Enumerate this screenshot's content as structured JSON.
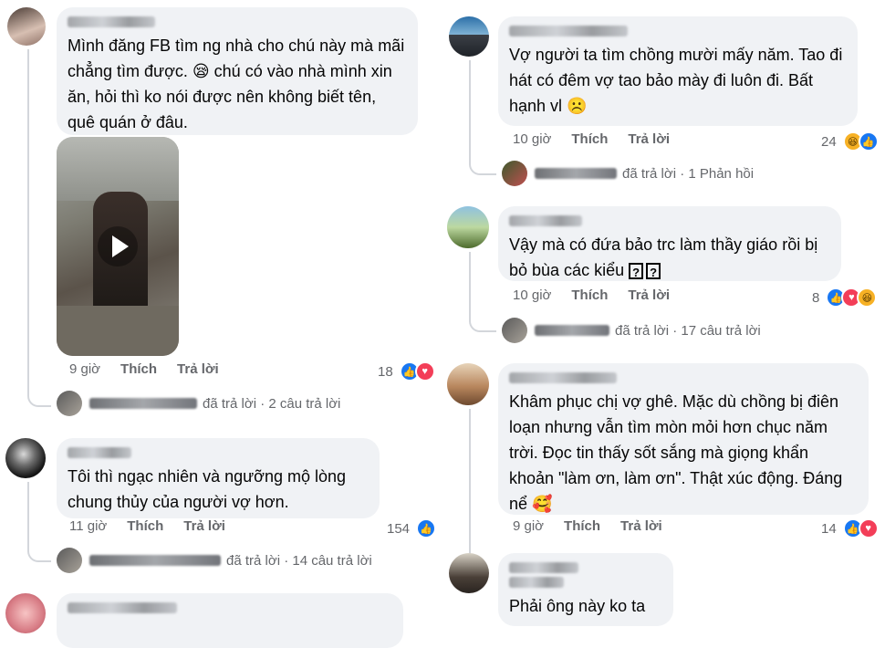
{
  "left": {
    "c1": {
      "text": "Mình đăng FB tìm ng nhà cho chú này mà mãi chẳng tìm được. 😪 chú có vào nhà mình xin ăn, hỏi thì ko nói được nên không biết tên, quê quán ở đâu.",
      "time": "9 giờ",
      "like": "Thích",
      "reply": "Trả lời",
      "count": "18",
      "reply_summary": "đã trả lời · 2 câu trả lời"
    },
    "c2": {
      "text": "Tôi thì ngạc nhiên và ngưỡng mộ lòng chung thủy của người vợ hơn.",
      "time": "11 giờ",
      "like": "Thích",
      "reply": "Trả lời",
      "count": "154",
      "reply_summary": "đã trả lời · 14 câu trả lời"
    }
  },
  "right": {
    "c1": {
      "text": "Vợ người ta tìm chồng mười mấy năm. Tao đi hát có đêm vợ tao bảo mày đi luôn đi. Bất hạnh vl ☹️",
      "time": "10 giờ",
      "like": "Thích",
      "reply": "Trả lời",
      "count": "24",
      "reply_summary": "đã trả lời · 1 Phản hồi"
    },
    "c2": {
      "text": "Vậy mà có đứa bảo trc làm thầy giáo rồi bị bỏ bùa các kiểu",
      "time": "10 giờ",
      "like": "Thích",
      "reply": "Trả lời",
      "count": "8",
      "reply_summary": "đã trả lời · 17 câu trả lời"
    },
    "c3": {
      "text": "Khâm phục chị vợ ghê. Mặc dù chồng bị điên loạn nhưng vẫn tìm mòn mỏi hơn chục năm trời. Đọc tin thấy sốt sắng mà giọng khẩn khoản \"làm ơn, làm ơn\". Thật xúc động. Đáng nể 🥰",
      "time": "9 giờ",
      "like": "Thích",
      "reply": "Trả lời",
      "count": "14"
    },
    "c4": {
      "text": "Phải ông này ko ta"
    }
  },
  "icons": {
    "like": "like-icon",
    "love": "love-icon",
    "haha": "haha-icon",
    "play": "play-icon"
  },
  "colors": {
    "bubble": "#f0f2f5",
    "meta": "#65676b",
    "like": "#1877f2",
    "love": "#f33e58",
    "haha": "#f7b125"
  }
}
